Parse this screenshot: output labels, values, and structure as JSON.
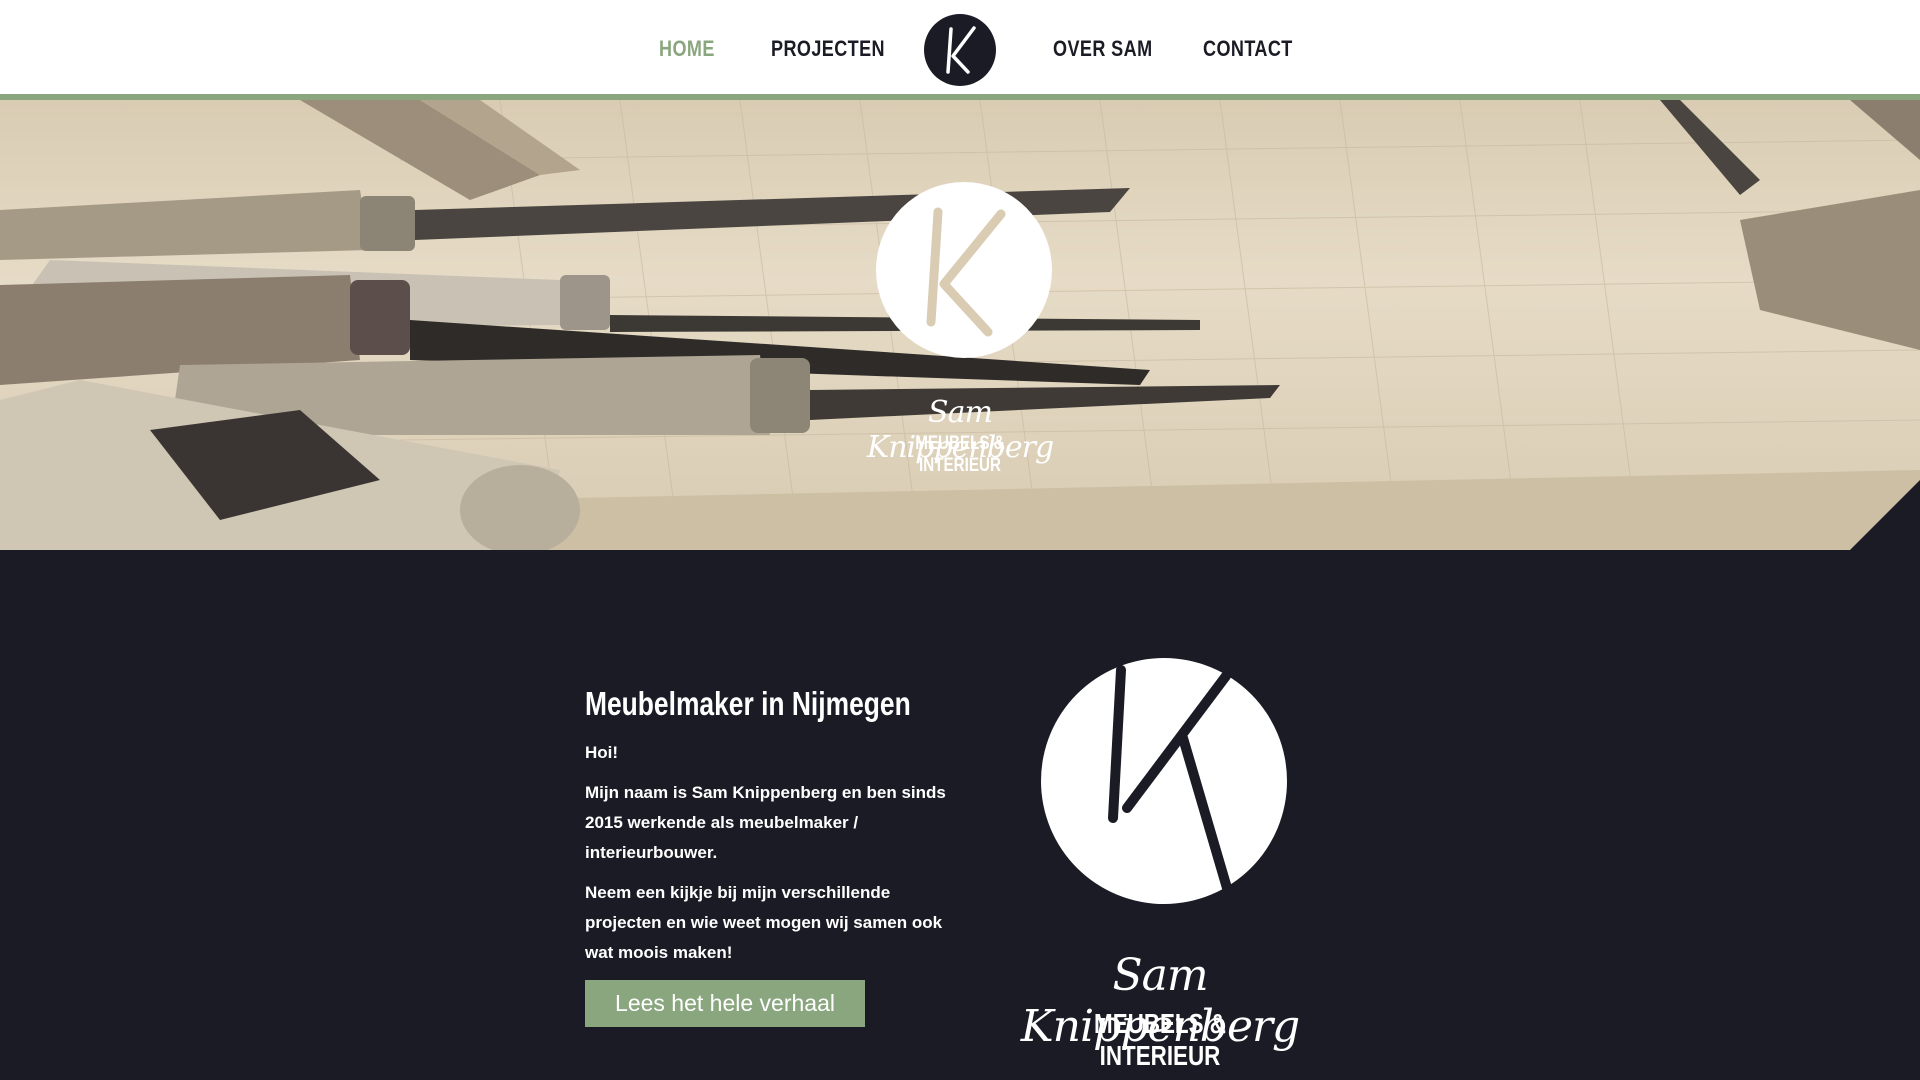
{
  "nav": {
    "items": [
      {
        "label": "HOME",
        "active": true
      },
      {
        "label": "PROJECTEN",
        "active": false
      },
      {
        "label": "OVER SAM",
        "active": false
      },
      {
        "label": "CONTACT",
        "active": false
      }
    ],
    "logo_icon": "k-monogram-icon"
  },
  "hero": {
    "logo_icon": "k-monogram-icon",
    "script_name": "Sam Knippenberg",
    "subtitle": "MEUBELS & INTERIEUR",
    "background": "chisels-on-wood-photo"
  },
  "intro": {
    "heading": "Meubelmaker in Nijmegen",
    "greeting": "Hoi!",
    "paragraph_1": "Mijn naam is Sam Knippenberg en ben sinds 2015 werkende als meubelmaker / interieurbouwer.",
    "paragraph_2": "Neem een kijkje bij mijn verschillende projecten en wie weet mogen wij samen ook wat moois maken!",
    "button_label": "Lees het hele verhaal"
  },
  "brand": {
    "logo_icon": "k-monogram-icon",
    "script_name": "Sam Knippenberg",
    "subtitle": "MEUBELS & INTERIEUR"
  },
  "colors": {
    "accent": "#8aa67f",
    "dark": "#1b1b26",
    "white": "#ffffff"
  }
}
